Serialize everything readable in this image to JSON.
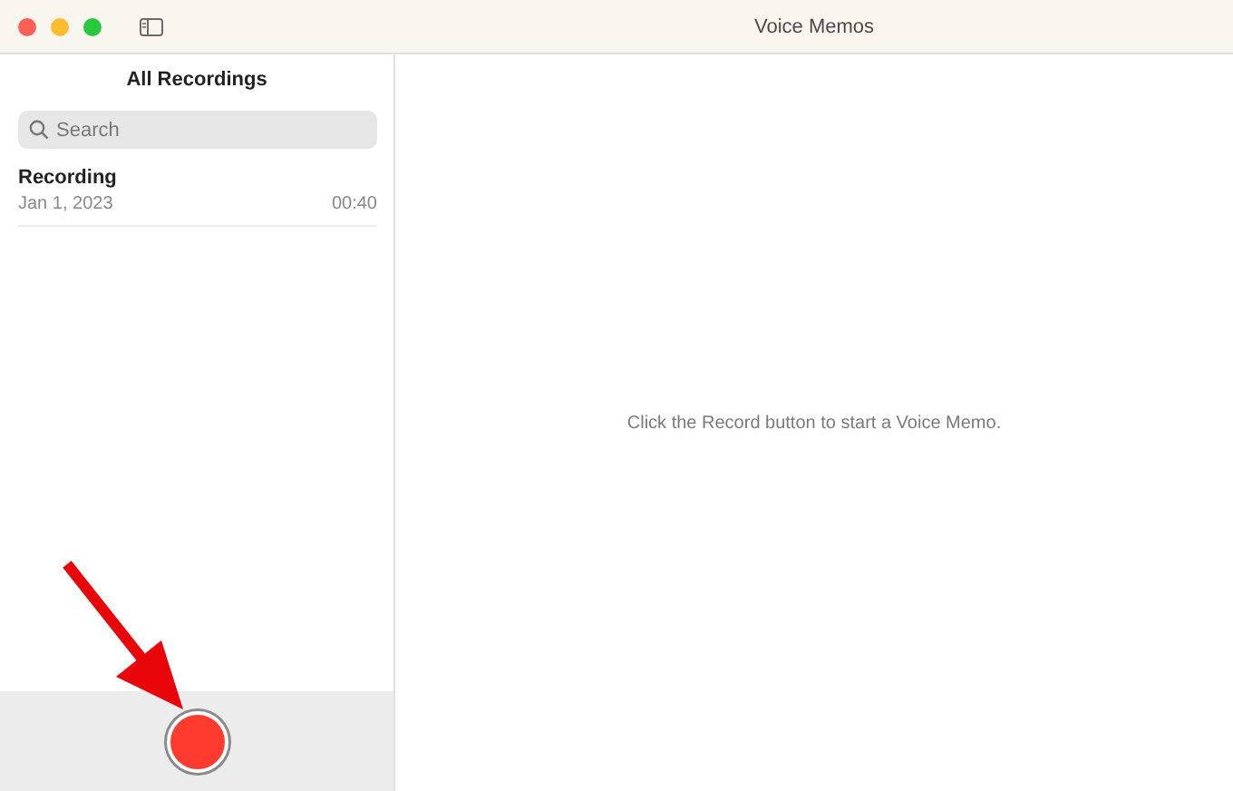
{
  "window": {
    "title": "Voice Memos"
  },
  "sidebar": {
    "title": "All Recordings",
    "search": {
      "placeholder": "Search"
    },
    "recordings": [
      {
        "name": "Recording",
        "date": "Jan 1, 2023",
        "duration": "00:40",
        "selected": false
      }
    ]
  },
  "detail": {
    "message": "Click the Record button to start a Voice Memo."
  }
}
